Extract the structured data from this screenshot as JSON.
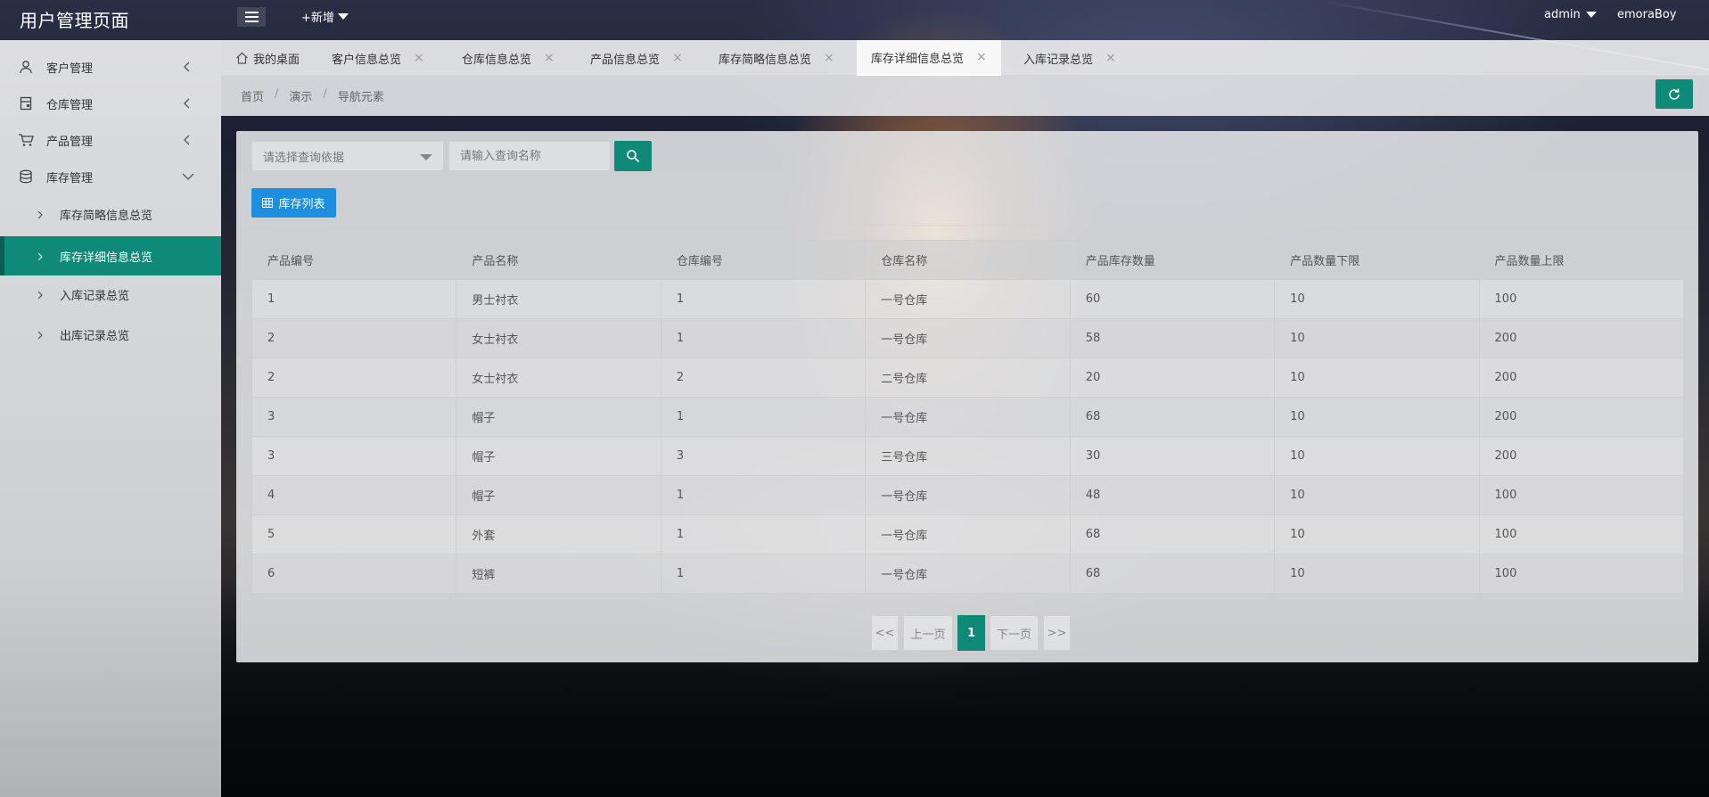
{
  "app": {
    "title": "用户管理页面"
  },
  "topbar": {
    "new_label": "+新增",
    "user_menu_label": "admin",
    "username": "emoraBoy"
  },
  "sidebar": {
    "groups": [
      {
        "label": "客户管理",
        "icon": "user-icon"
      },
      {
        "label": "仓库管理",
        "icon": "warehouse-icon"
      },
      {
        "label": "产品管理",
        "icon": "cart-icon"
      },
      {
        "label": "库存管理",
        "icon": "database-icon"
      }
    ],
    "subitems": [
      {
        "label": "库存简略信息总览"
      },
      {
        "label": "库存详细信息总览"
      },
      {
        "label": "入库记录总览"
      },
      {
        "label": "出库记录总览"
      }
    ]
  },
  "tabs": [
    {
      "label": "我的桌面"
    },
    {
      "label": "客户信息总览"
    },
    {
      "label": "仓库信息总览"
    },
    {
      "label": "产品信息总览"
    },
    {
      "label": "库存简略信息总览"
    },
    {
      "label": "库存详细信息总览"
    },
    {
      "label": "入库记录总览"
    }
  ],
  "tab_close_glyph": "×",
  "breadcrumb": {
    "items": [
      "首页",
      "演示",
      "导航元素"
    ],
    "separator": "/"
  },
  "search": {
    "select_placeholder": "请选择查询依据",
    "input_placeholder": "请输入查询名称"
  },
  "list_button_label": "库存列表",
  "table": {
    "headers": [
      "产品编号",
      "产品名称",
      "仓库编号",
      "仓库名称",
      "产品库存数量",
      "产品数量下限",
      "产品数量上限"
    ],
    "rows": [
      [
        "1",
        "男士衬衣",
        "1",
        "一号仓库",
        "60",
        "10",
        "100"
      ],
      [
        "2",
        "女士衬衣",
        "1",
        "一号仓库",
        "58",
        "10",
        "200"
      ],
      [
        "2",
        "女士衬衣",
        "2",
        "二号仓库",
        "20",
        "10",
        "200"
      ],
      [
        "3",
        "帽子",
        "1",
        "一号仓库",
        "68",
        "10",
        "200"
      ],
      [
        "3",
        "帽子",
        "3",
        "三号仓库",
        "30",
        "10",
        "200"
      ],
      [
        "4",
        "帽子",
        "1",
        "一号仓库",
        "48",
        "10",
        "100"
      ],
      [
        "5",
        "外套",
        "1",
        "一号仓库",
        "68",
        "10",
        "100"
      ],
      [
        "6",
        "短裤",
        "1",
        "一号仓库",
        "68",
        "10",
        "100"
      ]
    ]
  },
  "pagination": {
    "first": "<<",
    "prev": "上一页",
    "current": "1",
    "next": "下一页",
    "last": ">>"
  },
  "colors": {
    "accent": "#0f8a78",
    "primary_button": "#1e8fde"
  }
}
